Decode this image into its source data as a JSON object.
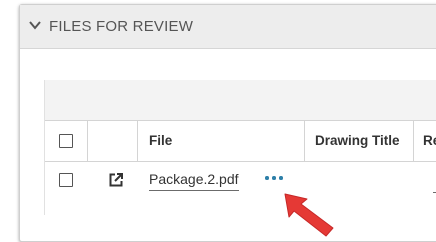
{
  "panel": {
    "title": "FILES FOR REVIEW",
    "chevron_icon": "chevron-down-icon"
  },
  "table": {
    "columns": [
      {
        "key": "select",
        "label": ""
      },
      {
        "key": "open",
        "label": ""
      },
      {
        "key": "file",
        "label": "File"
      },
      {
        "key": "drawing_title",
        "label": "Drawing Title"
      },
      {
        "key": "next",
        "label": "Re"
      }
    ],
    "rows": [
      {
        "file": "Package.2.pdf",
        "drawing_title": "",
        "open_icon": "open-external-icon",
        "more_icon": "more-options-icon"
      }
    ]
  },
  "colors": {
    "header_bg": "#ededed",
    "accent_dots": "#2d7fa8",
    "arrow": "#e53935"
  }
}
